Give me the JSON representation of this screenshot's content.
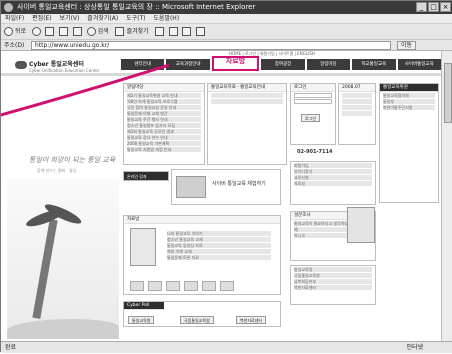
{
  "window": {
    "title": "사이버 통일교육센터 : 상상통일 통일교육의 장 :: Microsoft Internet Explorer",
    "controls": [
      "_",
      "□",
      "×"
    ]
  },
  "menubar": [
    "파일(F)",
    "편집(E)",
    "보기(V)",
    "즐겨찾기(A)",
    "도구(T)",
    "도움말(H)"
  ],
  "toolbar": {
    "back_label": "뒤로",
    "search_label": "검색",
    "favorites_label": "즐겨찾기"
  },
  "address": {
    "label": "주소(D)",
    "url": "http://www.uniedu.go.kr/",
    "go_label": "이동"
  },
  "site": {
    "logo": "Cyber 통일교육센터",
    "logo_sub": "Cyber Unification Education Center",
    "toplinks": "HOME | 로그인 | 회원가입 | 사이트맵 | ENGLISH",
    "nav": [
      "센터안내",
      "교육과정안내",
      "자료방",
      "참여광장",
      "알림마당",
      "학교통일교육",
      "사이버통일교육"
    ],
    "highlight_index": 2,
    "hero_text": "통일이 희망이 되는 통일 교육",
    "hero_sub": "함께 만드는 평화 · 통일",
    "notice_title": "알림마당",
    "notice_items": [
      "제2기 통일교육위원 교육 안내",
      "'08년 하계 통일교육 프로그램",
      "국민 참여 통일교실 운영 안내",
      "통일문제 이해 교재 발간",
      "통일교육 주간 행사 안내",
      "청소년 통일캠프 참가자 모집",
      "제3회 통일교육 공모전 결과",
      "통일교육 강사 연수 안내",
      "2008 통일교육 기본계획",
      "통일교육 지원법 개정 안내"
    ],
    "center_tab": "통일교육자료",
    "center_tab2": "통일교육안내",
    "login_title": "로그인",
    "login_btn": "로그인",
    "calendar_title": "2008.07",
    "phone": "02-901-7114",
    "quick_items": [
      "회원가입",
      "아이디찾기",
      "교육신청",
      "자료실"
    ],
    "banner_text": "사이버 통일교육 체험하기",
    "banner_sub": "온라인 강좌",
    "data_title": "자료방",
    "data_items": [
      "나의 통일교육 이야기",
      "청소년 통일교육 교재",
      "통일교육 동영상 자료",
      "북한 이해 교재",
      "통일문제 토론 자료"
    ],
    "survey_title": "설문조사",
    "survey_q": "통일교육이 필요하다고 생각하십니까?",
    "poll_options": [
      "예",
      "아니오"
    ],
    "bottom_title": "Cyber Poll",
    "bottom_items": [
      "통일교육원",
      "국립통일교육원",
      "남북회담본부",
      "북한자료센터"
    ],
    "side_banners": [
      "통일교육위원",
      "통일교육협의회",
      "통일부",
      "북한이탈주민지원"
    ]
  },
  "status": {
    "text": "완료",
    "zone": "인터넷"
  }
}
